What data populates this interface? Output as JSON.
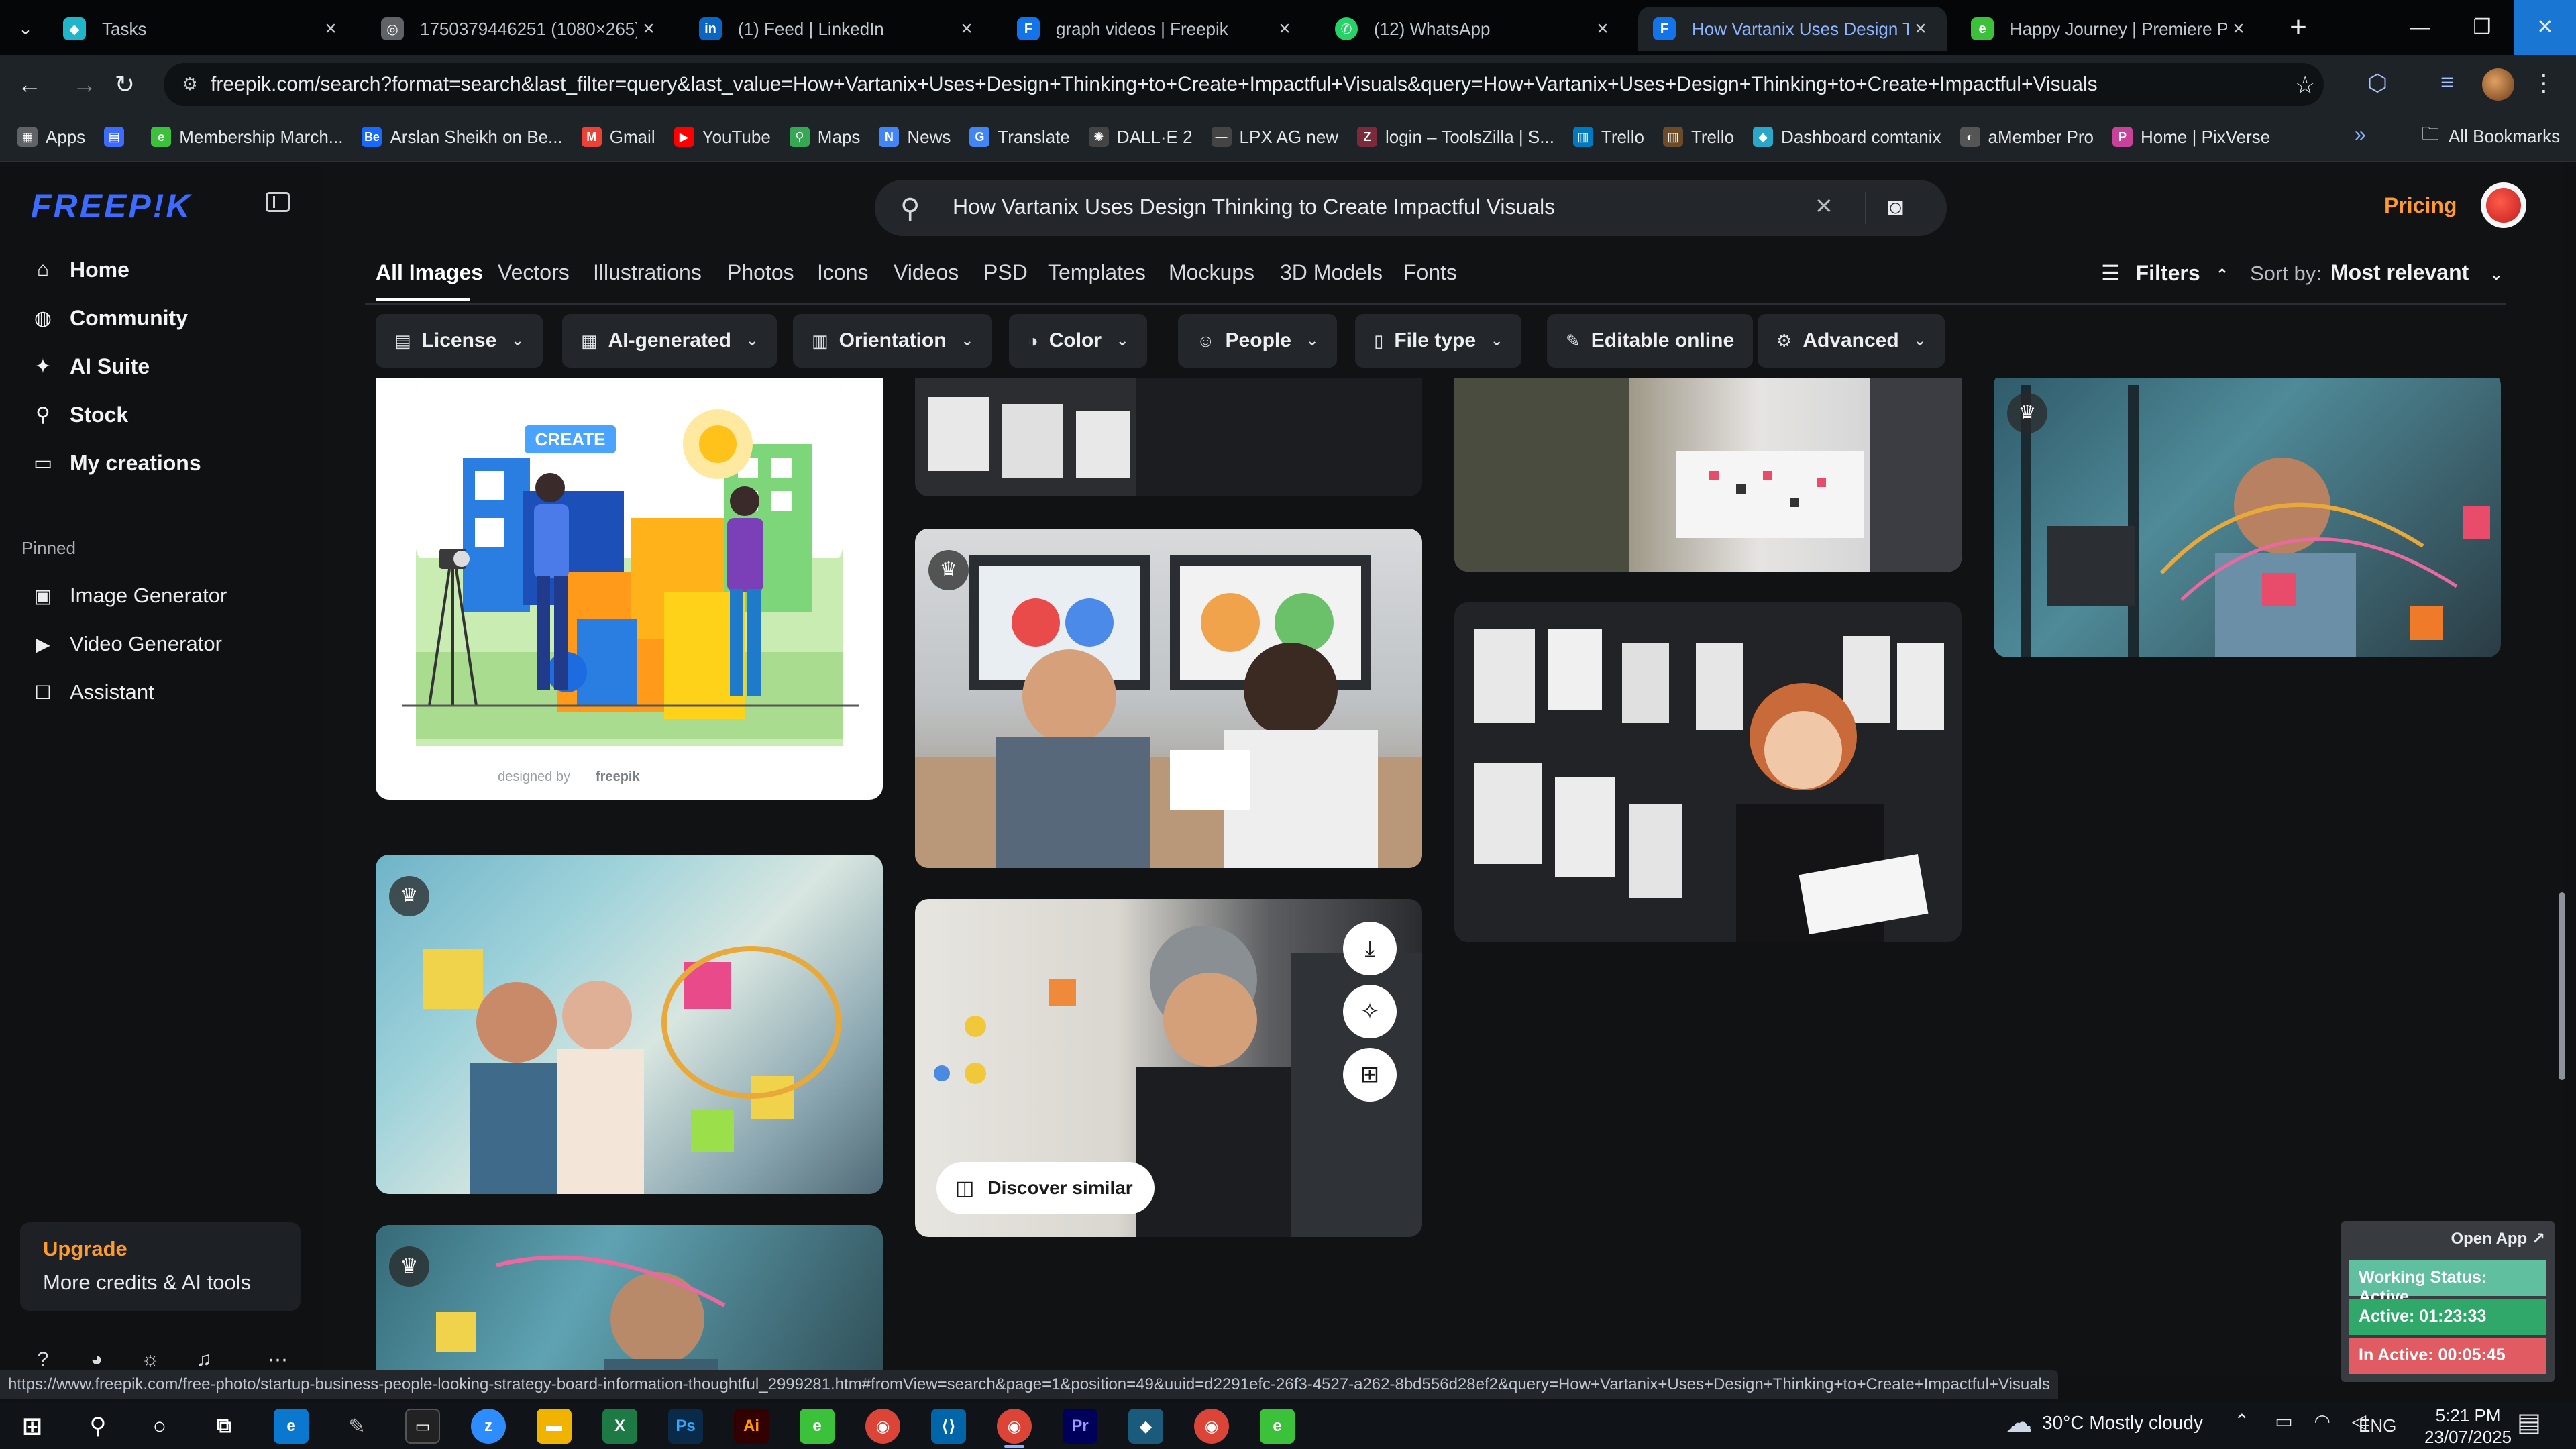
{
  "browser": {
    "tabs": [
      {
        "title": "Tasks",
        "icon": "tasks-icon",
        "color": "#20b6c9"
      },
      {
        "title": "1750379446251 (1080×265)",
        "icon": "globe-icon",
        "color": "#5f6368"
      },
      {
        "title": "(1) Feed | LinkedIn",
        "icon": "linkedin-icon",
        "color": "#0a66c2"
      },
      {
        "title": "graph videos | Freepik",
        "icon": "freepik-icon",
        "color": "#1273eb"
      },
      {
        "title": "(12) WhatsApp",
        "icon": "whatsapp-icon",
        "color": "#25d366"
      },
      {
        "title": "How Vartanix Uses Design Thin",
        "icon": "freepik-icon",
        "color": "#1273eb"
      },
      {
        "title": "Happy Journey | Premiere Pro",
        "icon": "envato-icon",
        "color": "#3cc13b"
      }
    ],
    "active_tab_index": 5,
    "url": "freepik.com/search?format=search&last_filter=query&last_value=How+Vartanix+Uses+Design+Thinking+to+Create+Impactful+Visuals&query=How+Vartanix+Uses+Design+Thinking+to+Create+Impactful+Visuals",
    "bookmarks": [
      {
        "label": "Apps",
        "icon": "apps-grid-icon",
        "color": "#5f6368"
      },
      {
        "label": "",
        "icon": "tab-groups-icon",
        "color": "#3d6bff"
      },
      {
        "label": "Membership March...",
        "icon": "envato-icon",
        "color": "#3cc13b"
      },
      {
        "label": "Arslan Sheikh on Be...",
        "icon": "behance-icon",
        "color": "#1769ff"
      },
      {
        "label": "Gmail",
        "icon": "gmail-icon",
        "color": "#ea4335"
      },
      {
        "label": "YouTube",
        "icon": "youtube-icon",
        "color": "#ff0000"
      },
      {
        "label": "Maps",
        "icon": "maps-icon",
        "color": "#34a853"
      },
      {
        "label": "News",
        "icon": "news-icon",
        "color": "#4285f4"
      },
      {
        "label": "Translate",
        "icon": "translate-icon",
        "color": "#4285f4"
      },
      {
        "label": "DALL·E 2",
        "icon": "openai-icon",
        "color": "#444"
      },
      {
        "label": "LPX AG new",
        "icon": "link-icon",
        "color": "#444"
      },
      {
        "label": "login – ToolsZilla | S...",
        "icon": "toolszilla-icon",
        "color": "#7a2a3a"
      },
      {
        "label": "Trello",
        "icon": "trello-icon",
        "color": "#0079bf"
      },
      {
        "label": "Trello",
        "icon": "trello-icon",
        "color": "#6b4b2a"
      },
      {
        "label": "Dashboard comtanix",
        "icon": "comtanix-icon",
        "color": "#2aa6c9"
      },
      {
        "label": "aMember Pro",
        "icon": "amember-icon",
        "color": "#555"
      },
      {
        "label": "Home | PixVerse",
        "icon": "pixverse-icon",
        "color": "#c8419a"
      }
    ],
    "all_bookmarks": "All Bookmarks",
    "status_url": "https://www.freepik.com/free-photo/startup-business-people-looking-strategy-board-information-thoughtful_2999281.htm#fromView=search&page=1&position=49&uuid=d2291efc-26f3-4527-a262-8bd556d28ef2&query=How+Vartanix+Uses+Design+Thinking+to+Create+Impactful+Visuals"
  },
  "sidebar": {
    "logo": "FREEP!K",
    "nav": [
      {
        "label": "Home",
        "icon": "home-icon"
      },
      {
        "label": "Community",
        "icon": "globe-icon"
      },
      {
        "label": "AI Suite",
        "icon": "sparkle-icon"
      },
      {
        "label": "Stock",
        "icon": "search-icon"
      },
      {
        "label": "My creations",
        "icon": "folder-icon"
      }
    ],
    "pinned_label": "Pinned",
    "pinned": [
      {
        "label": "Image Generator",
        "icon": "image-icon"
      },
      {
        "label": "Video Generator",
        "icon": "video-icon"
      },
      {
        "label": "Assistant",
        "icon": "chat-icon"
      }
    ],
    "upgrade": {
      "title": "Upgrade",
      "subtitle": "More credits & AI tools"
    }
  },
  "header": {
    "search_query": "How Vartanix Uses Design Thinking to Create Impactful Visuals",
    "pricing": "Pricing",
    "type_tabs": [
      "All Images",
      "Vectors",
      "Illustrations",
      "Photos",
      "Icons",
      "Videos",
      "PSD",
      "Templates",
      "Mockups",
      "3D Models",
      "Fonts"
    ],
    "active_type": "All Images",
    "filters_label": "Filters",
    "sort_label": "Sort by:",
    "sort_value": "Most relevant",
    "chips": [
      {
        "label": "License",
        "icon": "license-icon"
      },
      {
        "label": "AI-generated",
        "icon": "ai-icon"
      },
      {
        "label": "Orientation",
        "icon": "orientation-icon"
      },
      {
        "label": "Color",
        "icon": "palette-icon"
      },
      {
        "label": "People",
        "icon": "people-icon"
      },
      {
        "label": "File type",
        "icon": "file-icon"
      },
      {
        "label": "Editable online",
        "icon": "pencil-icon"
      },
      {
        "label": "Advanced",
        "icon": "gear-icon"
      }
    ]
  },
  "results": {
    "illustration_credit": "designed by",
    "illustration_brand": "freepik",
    "illustration_word": "CREATE",
    "discover_similar": "Discover similar"
  },
  "widget": {
    "open_app": "Open App ↗",
    "working_status": "Working Status: Active",
    "active": "Active: 01:23:33",
    "inactive": "In Active: 00:05:45",
    "colors": {
      "status": "#5fbf9f",
      "active": "#2fa86a",
      "inactive": "#e15b62"
    }
  },
  "taskbar": {
    "weather": "30°C  Mostly cloudy",
    "lang": "ENG",
    "time": "5:21 PM",
    "date": "23/07/2025"
  }
}
